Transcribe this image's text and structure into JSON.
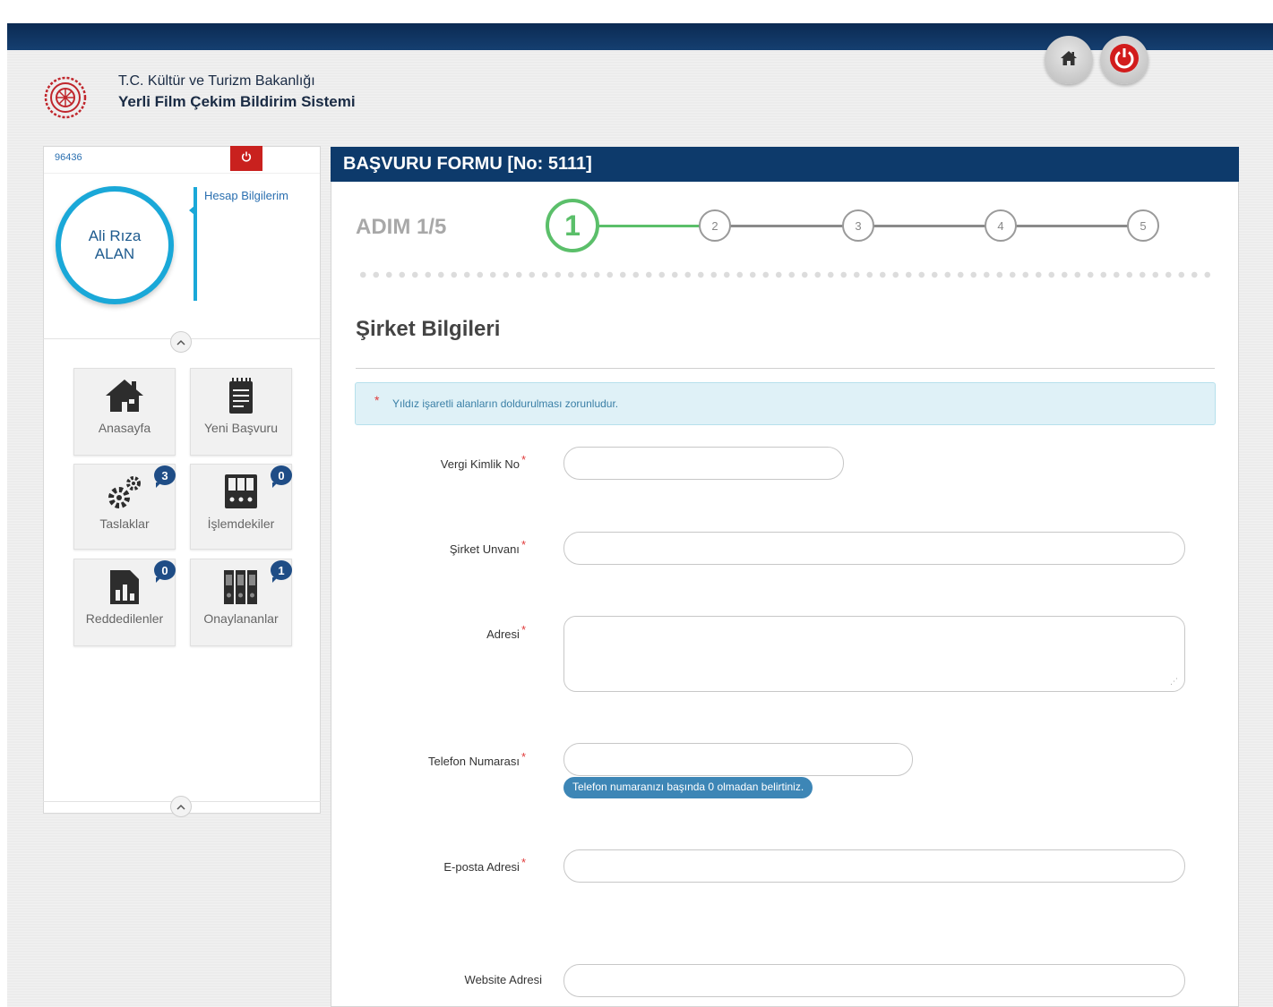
{
  "header": {
    "org_name": "T.C. Kültür ve Turizm Bakanlığı",
    "system_name": "Yerli Film Çekim Bildirim Sistemi",
    "home_icon": "home-icon",
    "power_icon": "power-icon"
  },
  "sidebar": {
    "user_id": "96436",
    "user_first": "Ali Rıza",
    "user_last": "ALAN",
    "account_link": "Hesap Bilgilerim",
    "tiles": [
      {
        "label": "Anasayfa",
        "icon": "house-icon"
      },
      {
        "label": "Yeni Başvuru",
        "icon": "notepad-icon"
      },
      {
        "label": "Taslaklar",
        "icon": "gears-icon",
        "badge": "3"
      },
      {
        "label": "İşlemdekiler",
        "icon": "binders-icon",
        "badge": "0"
      },
      {
        "label": "Reddedilenler",
        "icon": "bar-chart-icon",
        "badge": "0"
      },
      {
        "label": "Onaylananlar",
        "icon": "archive-icon",
        "badge": "1"
      }
    ]
  },
  "form": {
    "title": "BAŞVURU FORMU [No: 5111]",
    "step_label": "ADIM 1/5",
    "steps": [
      "1",
      "2",
      "3",
      "4",
      "5"
    ],
    "current_step": 1,
    "section_title": "Şirket Bilgileri",
    "required_note": "Yıldız işaretli alanların doldurulması zorunludur.",
    "fields": {
      "tax_no": {
        "label": "Vergi Kimlik No",
        "value": ""
      },
      "company_title": {
        "label": "Şirket Unvanı",
        "value": ""
      },
      "address": {
        "label": "Adresi",
        "value": ""
      },
      "phone": {
        "label": "Telefon Numarası",
        "value": "",
        "hint": "Telefon numaranızı başında 0 olmadan belirtiniz."
      },
      "email": {
        "label": "E-posta Adresi",
        "value": ""
      },
      "website": {
        "label": "Website Adresi",
        "value": ""
      }
    }
  },
  "colors": {
    "header_navy": "#0d3a6b",
    "accent_cyan": "#1aa8d8",
    "step_green": "#5bbf6a",
    "danger_red": "#c9211e"
  }
}
